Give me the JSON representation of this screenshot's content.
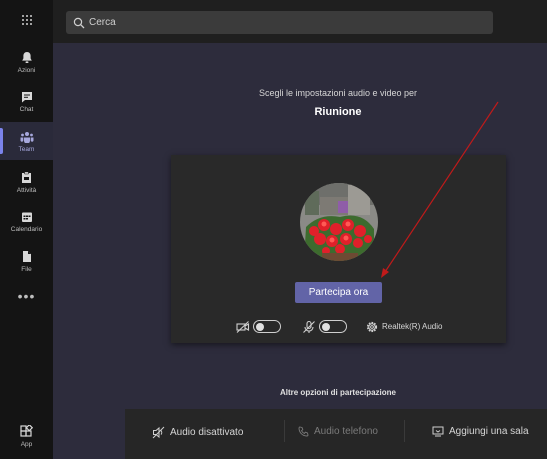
{
  "rail": {
    "items": [
      {
        "label": "Azioni",
        "icon": "bell-icon"
      },
      {
        "label": "Chat",
        "icon": "chat-icon"
      },
      {
        "label": "Team",
        "icon": "team-icon"
      },
      {
        "label": "Attività",
        "icon": "assignment-icon"
      },
      {
        "label": "Calendario",
        "icon": "calendar-icon"
      },
      {
        "label": "File",
        "icon": "file-icon"
      }
    ],
    "more_label": "•••",
    "app_label": "App",
    "active": "Team"
  },
  "search": {
    "placeholder": "Cerca"
  },
  "prejoin": {
    "subtitle": "Scegli le impostazioni audio e video per",
    "meeting_title": "Riunione",
    "join_label": "Partecipa ora",
    "audio_device": "Realtek(R) Audio"
  },
  "other_options": {
    "heading": "Altre opzioni di partecipazione",
    "audio_off": "Audio disattivato",
    "phone_audio": "Audio telefono",
    "add_room": "Aggiungi una sala"
  },
  "colors": {
    "accent": "#6264a7",
    "rail_bg": "#141414",
    "content_bg": "#2d2c3c",
    "card_bg": "#292929",
    "arrow": "#c01a1a"
  }
}
